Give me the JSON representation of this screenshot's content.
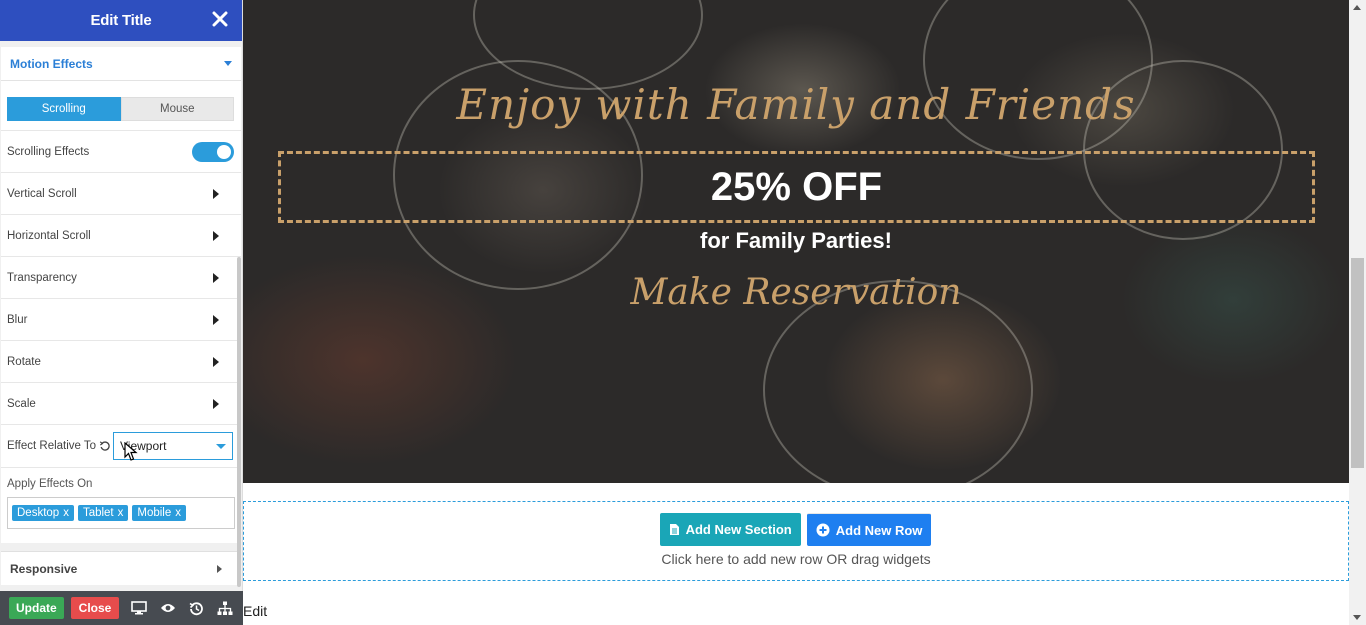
{
  "panel": {
    "title": "Edit Title",
    "motion_effects_label": "Motion Effects",
    "tabs": [
      {
        "label": "Scrolling",
        "active": true
      },
      {
        "label": "Mouse",
        "active": false
      }
    ],
    "scrolling_effects_label": "Scrolling Effects",
    "scrolling_effects_enabled": true,
    "effects": [
      {
        "label": "Vertical Scroll"
      },
      {
        "label": "Horizontal Scroll"
      },
      {
        "label": "Transparency"
      },
      {
        "label": "Blur"
      },
      {
        "label": "Rotate"
      },
      {
        "label": "Scale"
      }
    ],
    "effect_relative_label": "Effect Relative To",
    "effect_relative_value": "Viewport",
    "apply_effects_label": "Apply Effects On",
    "apply_tags": [
      "Desktop",
      "Tablet",
      "Mobile"
    ],
    "tag_remove": "x",
    "responsive_label": "Responsive"
  },
  "footer": {
    "update_label": "Update",
    "close_label": "Close",
    "icons": [
      "desktop-icon",
      "preview-eye-icon",
      "history-icon",
      "navigator-tree-icon"
    ]
  },
  "hero": {
    "headline": "Enjoy with Family and Friends",
    "offer": "25% OFF",
    "sub": "for Family Parties!",
    "cta": "Make Reservation"
  },
  "dropzone": {
    "add_section_label": "Add New Section",
    "add_row_label": "Add New Row",
    "hint": "Click here to add new row OR drag widgets"
  },
  "edit_label": "Edit",
  "colors": {
    "panel_header": "#2e4fbf",
    "accent": "#2b9cdb",
    "gold": "#c9a06a",
    "update": "#3aa856",
    "close": "#e74c4c",
    "footer": "#474b51"
  }
}
